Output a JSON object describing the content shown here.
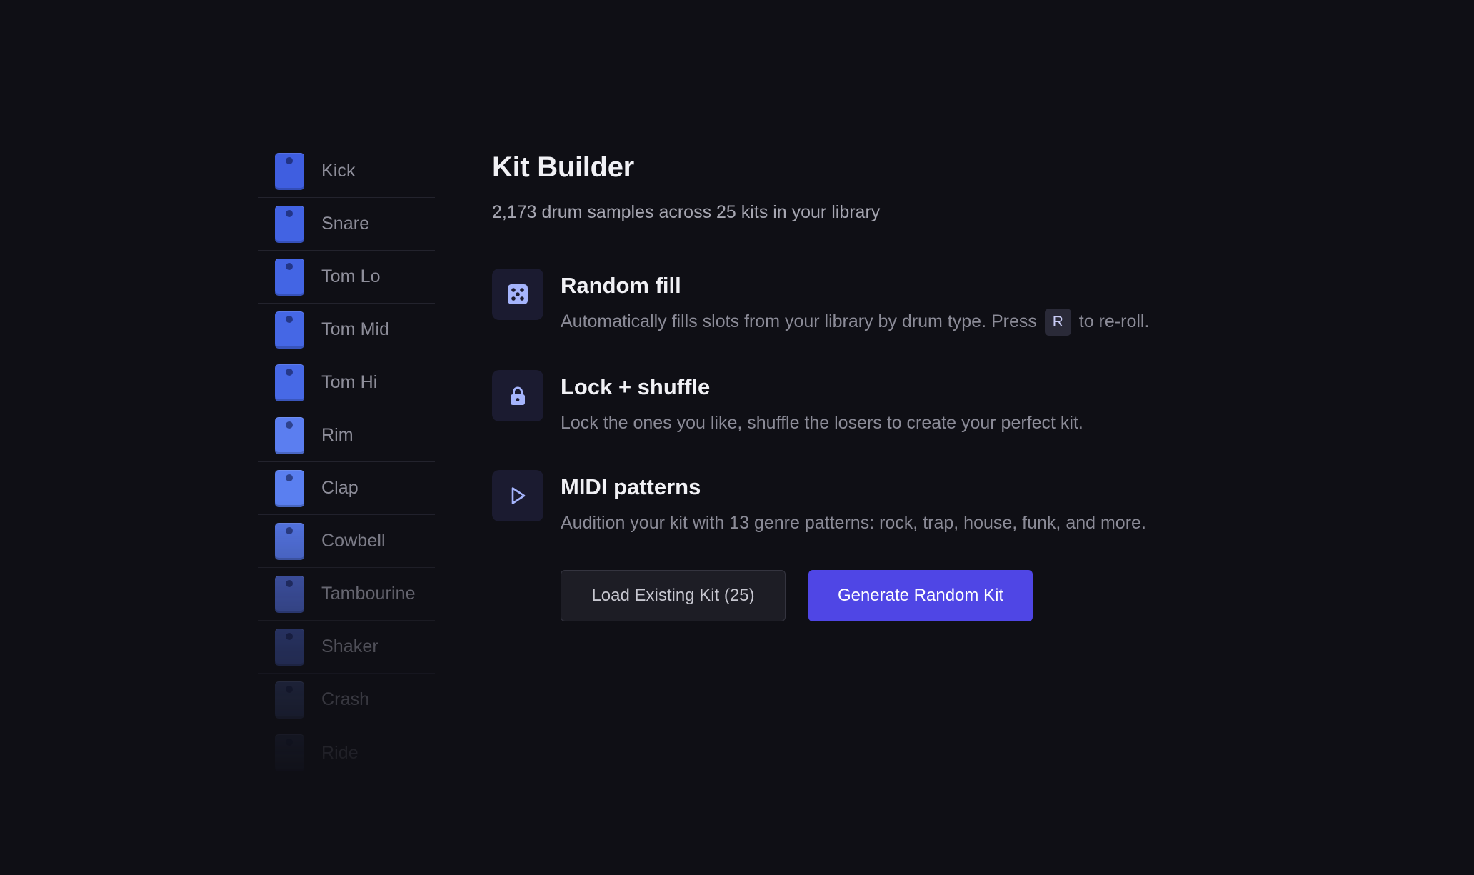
{
  "slots": [
    {
      "label": "Kick",
      "color": "#3f5ee0"
    },
    {
      "label": "Snare",
      "color": "#4263e3"
    },
    {
      "label": "Tom Lo",
      "color": "#4365e4"
    },
    {
      "label": "Tom Mid",
      "color": "#4567e5"
    },
    {
      "label": "Tom Hi",
      "color": "#4769e6"
    },
    {
      "label": "Rim",
      "color": "#5b7ef0"
    },
    {
      "label": "Clap",
      "color": "#5a7ff0"
    },
    {
      "label": "Cowbell",
      "color": "#5779ec"
    },
    {
      "label": "Tambourine",
      "color": "#4a63c8"
    },
    {
      "label": "Shaker",
      "color": "#3a4d9a"
    },
    {
      "label": "Crash",
      "color": "#33406e"
    },
    {
      "label": "Ride",
      "color": "#2a3356"
    }
  ],
  "header": {
    "title": "Kit Builder",
    "subtitle": "2,173 drum samples across 25 kits in your library"
  },
  "features": [
    {
      "icon": "dice-icon",
      "title": "Random fill",
      "desc_before": "Automatically fills slots from your library by drum type. Press",
      "key": "R",
      "desc_after": "to re-roll."
    },
    {
      "icon": "lock-icon",
      "title": "Lock + shuffle",
      "desc": "Lock the ones you like, shuffle the losers to create your perfect kit."
    },
    {
      "icon": "play-icon",
      "title": "MIDI patterns",
      "desc": "Audition your kit with 13 genre patterns: rock, trap, house, funk, and more."
    }
  ],
  "actions": {
    "load_label": "Load Existing Kit (25)",
    "generate_label": "Generate Random Kit"
  },
  "colors": {
    "accent": "#4f46e5",
    "icon_accent": "#a5b4fc",
    "background": "#0f0f15"
  }
}
